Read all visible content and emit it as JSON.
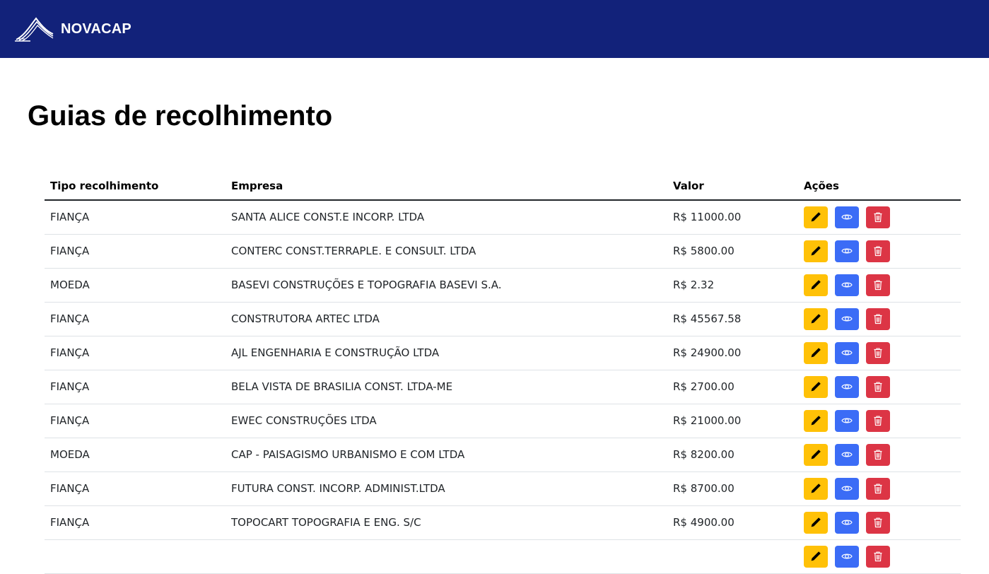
{
  "navbar": {
    "brand": "NOVACAP",
    "logo_icon": "novacap-logo-icon",
    "color": "#12227a"
  },
  "page": {
    "title": "Guias de recolhimento"
  },
  "table": {
    "headers": [
      "Tipo recolhimento",
      "Empresa",
      "Valor",
      "Ações"
    ],
    "rows": [
      {
        "tipo": "FIANÇA",
        "empresa": "SANTA ALICE CONST.E INCORP. LTDA",
        "valor": "R$ 11000.00"
      },
      {
        "tipo": "FIANÇA",
        "empresa": "CONTERC CONST.TERRAPLE. E CONSULT. LTDA",
        "valor": "R$ 5800.00"
      },
      {
        "tipo": "MOEDA",
        "empresa": "BASEVI CONSTRUÇÕES E TOPOGRAFIA BASEVI S.A.",
        "valor": "R$ 2.32"
      },
      {
        "tipo": "FIANÇA",
        "empresa": "CONSTRUTORA ARTEC LTDA",
        "valor": "R$ 45567.58"
      },
      {
        "tipo": "FIANÇA",
        "empresa": "AJL ENGENHARIA E CONSTRUÇÃO LTDA",
        "valor": "R$ 24900.00"
      },
      {
        "tipo": "FIANÇA",
        "empresa": "BELA VISTA DE BRASILIA CONST. LTDA-ME",
        "valor": "R$ 2700.00"
      },
      {
        "tipo": "FIANÇA",
        "empresa": "EWEC CONSTRUÇÕES LTDA",
        "valor": "R$ 21000.00"
      },
      {
        "tipo": "MOEDA",
        "empresa": "CAP - PAISAGISMO URBANISMO E COM LTDA",
        "valor": "R$ 8200.00"
      },
      {
        "tipo": "FIANÇA",
        "empresa": "FUTURA CONST. INCORP. ADMINIST.LTDA",
        "valor": "R$ 8700.00"
      },
      {
        "tipo": "FIANÇA",
        "empresa": "TOPOCART TOPOGRAFIA E ENG. S/C",
        "valor": "R$ 4900.00"
      },
      {
        "tipo": "",
        "empresa": "",
        "valor": ""
      }
    ],
    "action_icons": {
      "edit": "pencil-icon",
      "view": "eye-icon",
      "delete": "trash-icon"
    },
    "action_colors": {
      "edit": "#ffc107",
      "view": "#3b6cf6",
      "delete": "#dc3545"
    }
  }
}
